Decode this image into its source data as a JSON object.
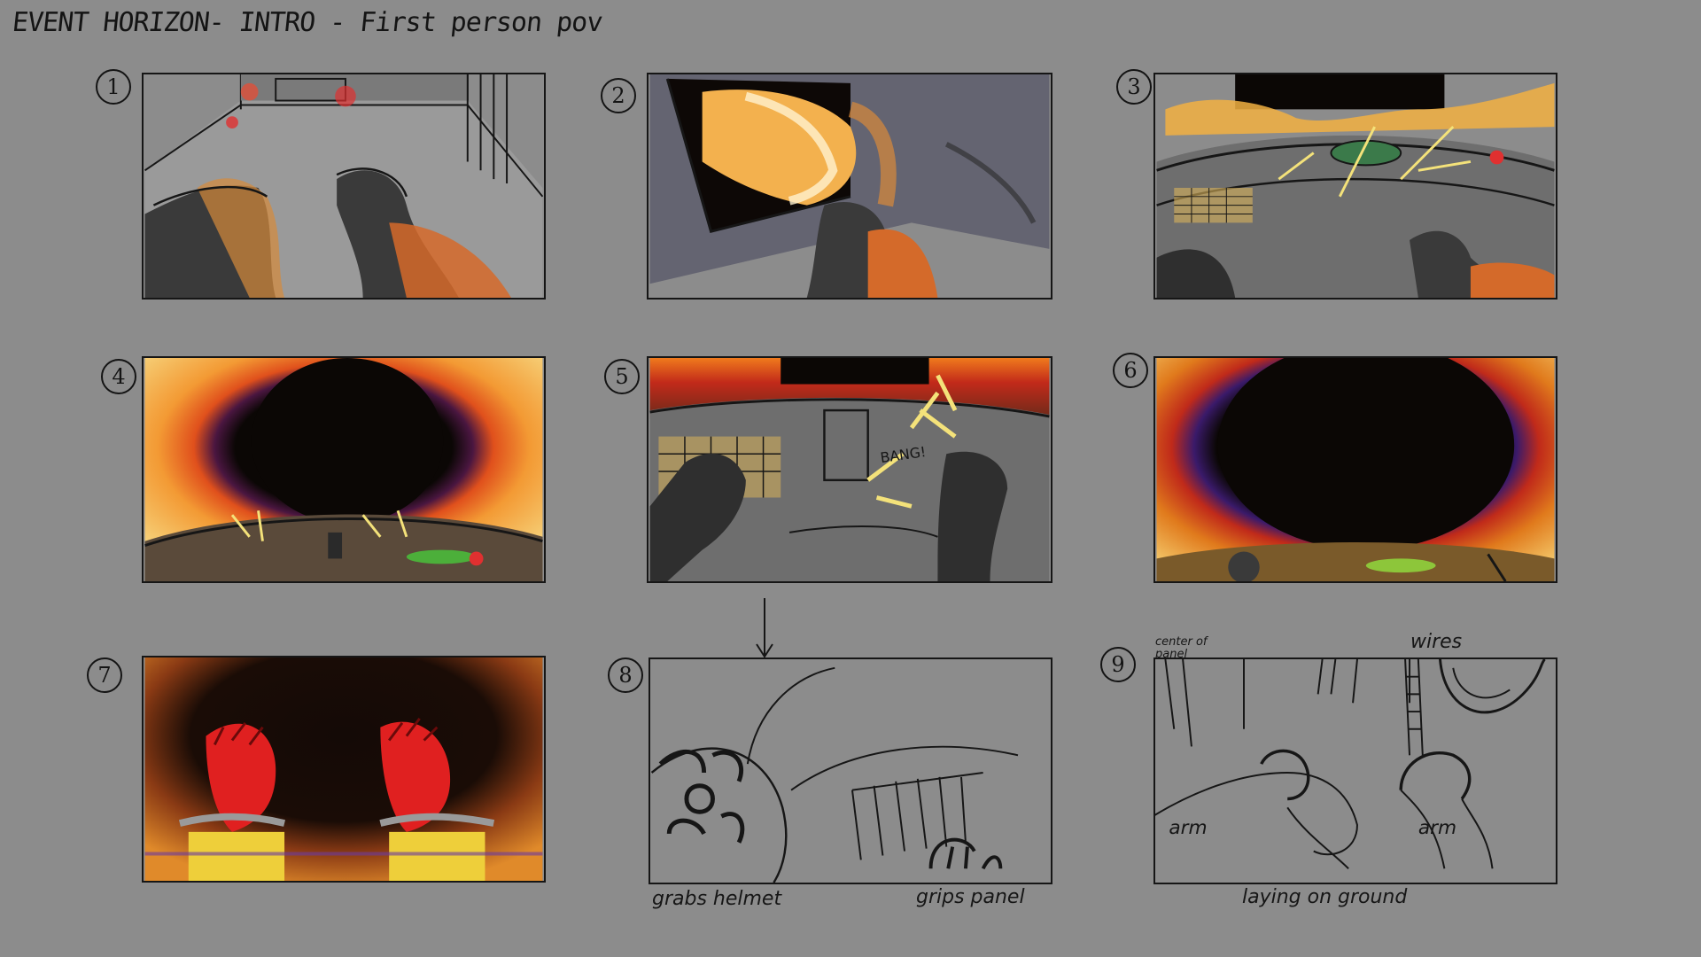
{
  "board": {
    "title": "EVENT HORIZON- INTRO - First person pov"
  },
  "panels": [
    {
      "number": "1"
    },
    {
      "number": "2"
    },
    {
      "number": "3"
    },
    {
      "number": "4"
    },
    {
      "number": "5",
      "sfx": "BANG!"
    },
    {
      "number": "6"
    },
    {
      "number": "7"
    },
    {
      "number": "8",
      "caption_left": "grabs helmet",
      "caption_right": "grips panel"
    },
    {
      "number": "9",
      "label_center": "center of panel",
      "label_wires": "wires",
      "label_arm_left": "arm",
      "label_arm_right": "arm",
      "caption": "laying on ground"
    }
  ],
  "colors": {
    "background": "#8c8c8c",
    "ink": "#161616",
    "accretion_orange": "#f07a1c",
    "accretion_yellow": "#f4c23a",
    "glove_red": "#e02020",
    "void": "#0b0705"
  }
}
